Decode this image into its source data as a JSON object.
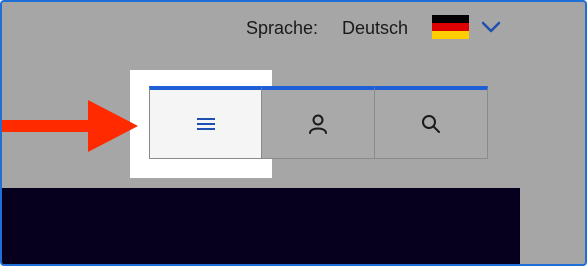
{
  "language": {
    "label": "Sprache:",
    "value": "Deutsch",
    "flag_icon": "germany-flag-icon",
    "flag_colors": [
      "#000000",
      "#dd0000",
      "#ffce00"
    ]
  },
  "nav": {
    "buttons": [
      {
        "icon": "menu-icon",
        "active": true
      },
      {
        "icon": "user-icon",
        "active": false
      },
      {
        "icon": "search-icon",
        "active": false
      }
    ]
  },
  "annotation": {
    "icon": "red-arrow-pointer",
    "color": "#ff2a00"
  },
  "colors": {
    "accent": "#1f5fd6",
    "backdrop": "#a6a6a6",
    "dark_panel": "#06001e",
    "frame": "#1f6fd6"
  }
}
